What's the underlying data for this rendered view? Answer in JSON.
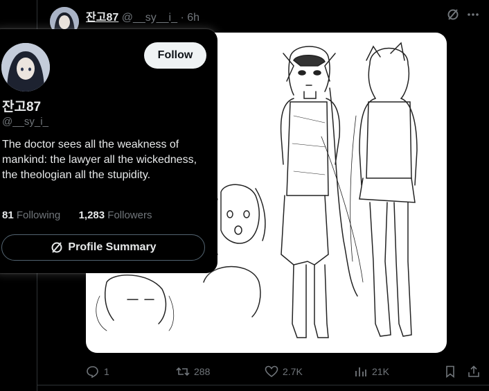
{
  "tweet": {
    "author_name": "잔고87",
    "author_handle": "@__sy__i_",
    "separator": "·",
    "time": "6h",
    "actions": {
      "reply_count": "1",
      "retweet_count": "288",
      "like_count": "2.7K",
      "view_count": "21K"
    },
    "media_icon": "sketch-illustration"
  },
  "hover_card": {
    "display_name": "잔고87",
    "handle": "@__sy_i_",
    "follow_label": "Follow",
    "bio": "The doctor sees all the weakness of mankind: the lawyer all the wickedness, the theologian all the stupidity.",
    "following_count": "81",
    "following_label": "Following",
    "followers_count": "1,283",
    "followers_label": "Followers",
    "summary_label": "Profile Summary"
  },
  "colors": {
    "background": "#000000",
    "text": "#e7e9ea",
    "muted": "#71767b",
    "border": "#2f3336",
    "follow_bg": "#eff3f4"
  }
}
